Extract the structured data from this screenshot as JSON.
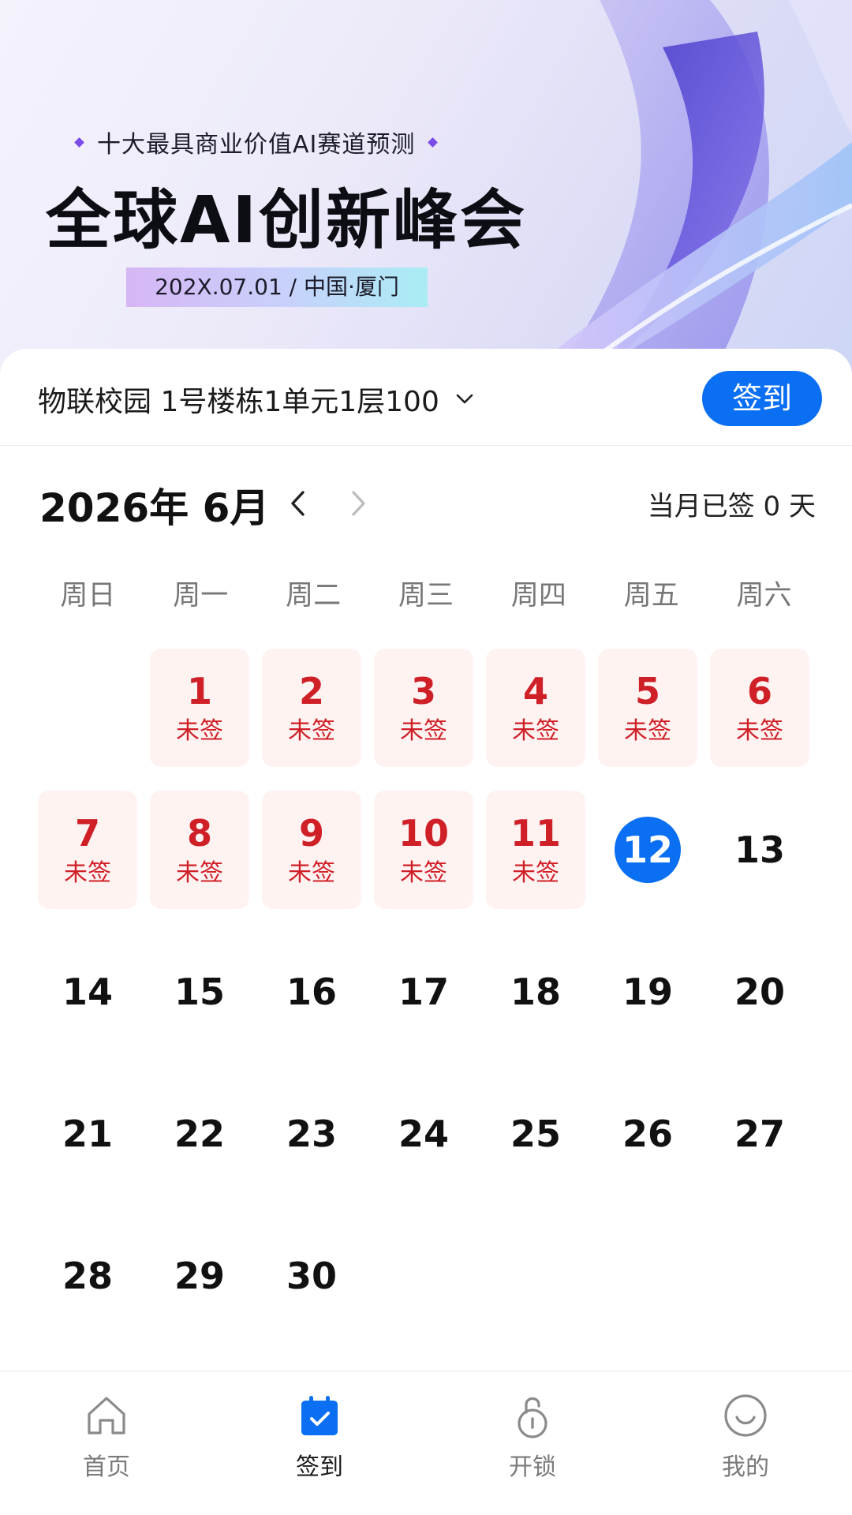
{
  "banner": {
    "subtitle": "十大最具商业价值AI赛道预测",
    "title": "全球AI创新峰会",
    "tag": "202X.07.01 / 中国·厦门"
  },
  "location": {
    "label": "物联校园 1号楼栋1单元1层100",
    "icon": "chevron-down-icon"
  },
  "signin_button": "签到",
  "calendar": {
    "month_label": "2026年 6月",
    "signed_summary": "当月已签 0 天",
    "weekdays": [
      "周日",
      "周一",
      "周二",
      "周三",
      "周四",
      "周五",
      "周六"
    ],
    "unsigned_label": "未签",
    "first_weekday_index": 1,
    "today": 12,
    "days": [
      {
        "n": "1",
        "status": "未签"
      },
      {
        "n": "2",
        "status": "未签"
      },
      {
        "n": "3",
        "status": "未签"
      },
      {
        "n": "4",
        "status": "未签"
      },
      {
        "n": "5",
        "status": "未签"
      },
      {
        "n": "6",
        "status": "未签"
      },
      {
        "n": "7",
        "status": "未签"
      },
      {
        "n": "8",
        "status": "未签"
      },
      {
        "n": "9",
        "status": "未签"
      },
      {
        "n": "10",
        "status": "未签"
      },
      {
        "n": "11",
        "status": "未签"
      },
      {
        "n": "12",
        "status": ""
      },
      {
        "n": "13",
        "status": ""
      },
      {
        "n": "14",
        "status": ""
      },
      {
        "n": "15",
        "status": ""
      },
      {
        "n": "16",
        "status": ""
      },
      {
        "n": "17",
        "status": ""
      },
      {
        "n": "18",
        "status": ""
      },
      {
        "n": "19",
        "status": ""
      },
      {
        "n": "20",
        "status": ""
      },
      {
        "n": "21",
        "status": ""
      },
      {
        "n": "22",
        "status": ""
      },
      {
        "n": "23",
        "status": ""
      },
      {
        "n": "24",
        "status": ""
      },
      {
        "n": "25",
        "status": ""
      },
      {
        "n": "26",
        "status": ""
      },
      {
        "n": "27",
        "status": ""
      },
      {
        "n": "28",
        "status": ""
      },
      {
        "n": "29",
        "status": ""
      },
      {
        "n": "30",
        "status": ""
      }
    ]
  },
  "tabs": [
    {
      "label": "首页",
      "icon": "home-icon",
      "active": false
    },
    {
      "label": "签到",
      "icon": "calendar-check-icon",
      "active": true
    },
    {
      "label": "开锁",
      "icon": "unlock-icon",
      "active": false
    },
    {
      "label": "我的",
      "icon": "smile-icon",
      "active": false
    }
  ],
  "colors": {
    "accent": "#0a6ff2",
    "unsigned_text": "#cf1f27",
    "unsigned_bg": "#fff3f2"
  }
}
